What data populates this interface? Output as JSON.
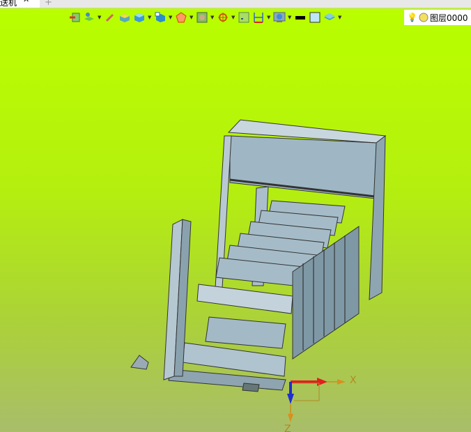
{
  "tab": {
    "title": "送机",
    "close": "✕",
    "new": "+"
  },
  "toolbar": {
    "icons": [
      "exit-sketch-icon",
      "layer-manager-icon",
      "brush-icon",
      "face-icon",
      "solid-box-icon",
      "view-cube-icon",
      "polygon-icon",
      "material-icon",
      "snap-point-icon",
      "frame-icon",
      "dimension-icon",
      "render-icon",
      "line-color-icon",
      "fill-color-icon",
      "layers-stack-icon"
    ]
  },
  "layer": {
    "name": "图层0000"
  },
  "axes": {
    "x": "X",
    "z": "Z"
  },
  "colors": {
    "background_top": "#b9fe00",
    "background_bottom": "#a9bd6a",
    "model": "#9fb7c4",
    "x_axis": "#e02020",
    "z_axis": "#2030d0"
  }
}
